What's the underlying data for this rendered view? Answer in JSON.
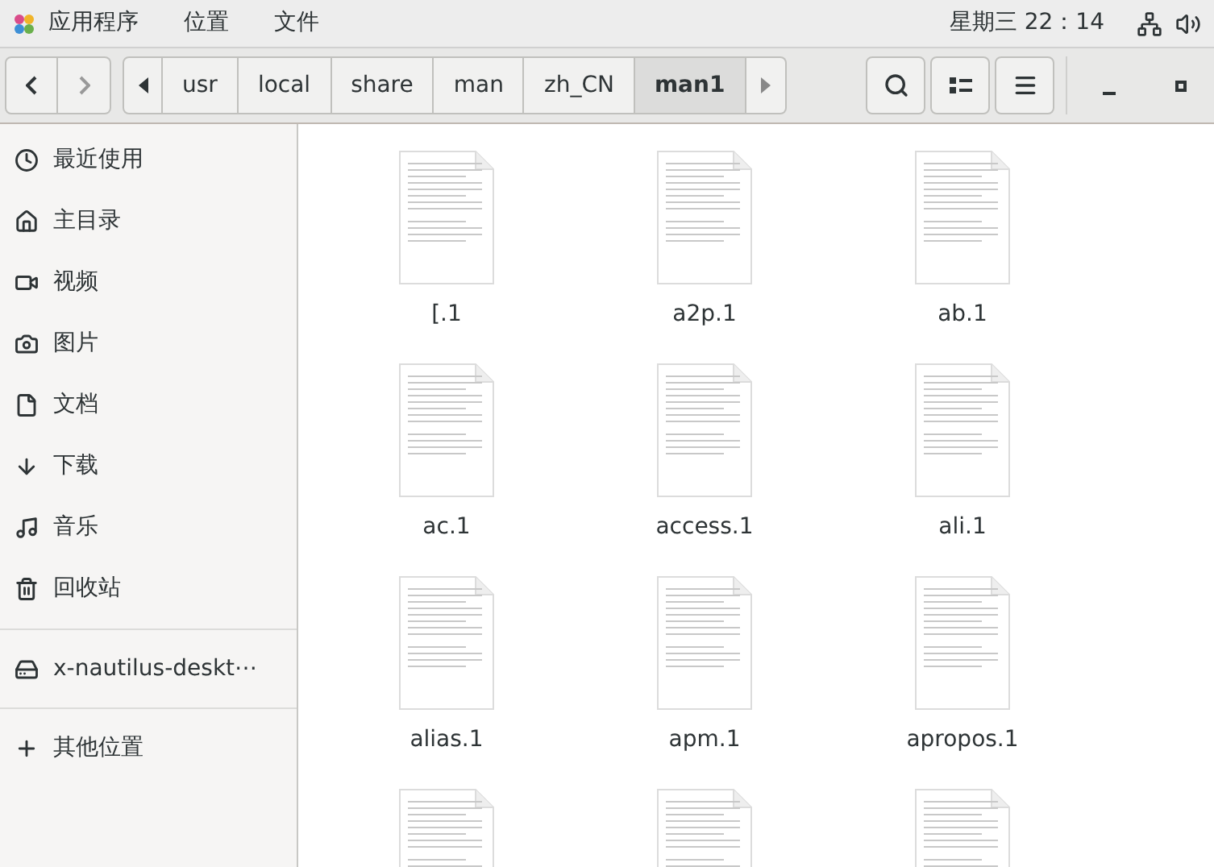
{
  "top_bar": {
    "menus": [
      "应用程序",
      "位置",
      "文件"
    ],
    "clock": "星期三 22：14"
  },
  "path_bar": {
    "segments": [
      {
        "label": "usr",
        "selected": false
      },
      {
        "label": "local",
        "selected": false
      },
      {
        "label": "share",
        "selected": false
      },
      {
        "label": "man",
        "selected": false
      },
      {
        "label": "zh_CN",
        "selected": false
      },
      {
        "label": "man1",
        "selected": true
      }
    ]
  },
  "sidebar": {
    "sections": [
      {
        "items": [
          {
            "kind": "recent",
            "label": "最近使用"
          },
          {
            "kind": "home",
            "label": "主目录"
          },
          {
            "kind": "video",
            "label": "视频"
          },
          {
            "kind": "pictures",
            "label": "图片"
          },
          {
            "kind": "documents",
            "label": "文档"
          },
          {
            "kind": "downloads",
            "label": "下载"
          },
          {
            "kind": "music",
            "label": "音乐"
          },
          {
            "kind": "trash",
            "label": "回收站"
          }
        ]
      },
      {
        "items": [
          {
            "kind": "drive",
            "label": "x-nautilus-deskt⋯"
          }
        ]
      },
      {
        "items": [
          {
            "kind": "other",
            "label": "其他位置"
          }
        ]
      }
    ]
  },
  "files": [
    {
      "kind": "document",
      "name": "[.1"
    },
    {
      "kind": "document",
      "name": "a2p.1"
    },
    {
      "kind": "document",
      "name": "ab.1"
    },
    {
      "kind": "document",
      "name": "ac.1"
    },
    {
      "kind": "document",
      "name": "access.1"
    },
    {
      "kind": "document",
      "name": "ali.1"
    },
    {
      "kind": "document",
      "name": "alias.1"
    },
    {
      "kind": "document",
      "name": "apm.1"
    },
    {
      "kind": "document",
      "name": "apropos.1"
    },
    {
      "kind": "document"
    },
    {
      "kind": "document"
    },
    {
      "kind": "document"
    }
  ]
}
